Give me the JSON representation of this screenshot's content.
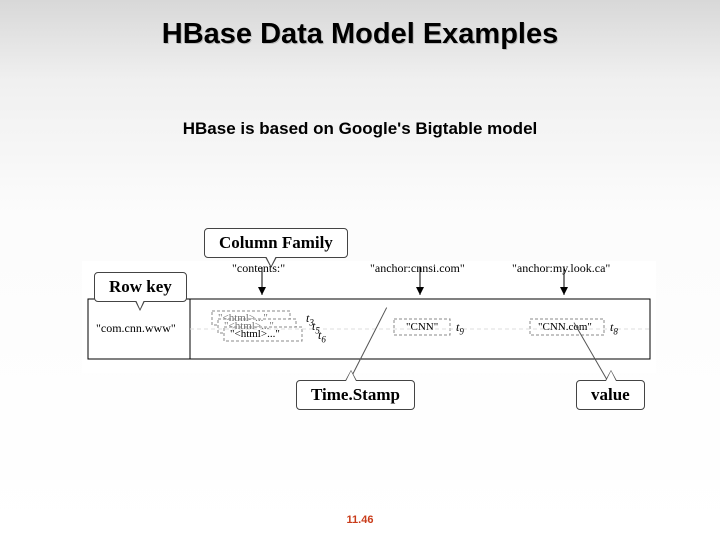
{
  "title": "HBase Data Model Examples",
  "subtitle": "HBase is based on Google's Bigtable model",
  "callouts": {
    "column_family": "Column Family",
    "row_key": "Row key",
    "timestamp": "Time.Stamp",
    "value": "value"
  },
  "diagram": {
    "row_key_value": "\"com.cnn.www\"",
    "columns": [
      {
        "header": "\"contents:\"",
        "values": [
          "\"<html>...\"",
          "\"<html>...\"",
          "\"<html>...\""
        ],
        "timestamps": [
          "t3",
          "t5",
          "t6"
        ]
      },
      {
        "header": "\"anchor:cnnsi.com\"",
        "values": [
          "\"CNN\""
        ],
        "timestamps": [
          "t9"
        ]
      },
      {
        "header": "\"anchor:my.look.ca\"",
        "values": [
          "\"CNN.com\""
        ],
        "timestamps": [
          "t8"
        ]
      }
    ]
  },
  "footer": "11.46"
}
